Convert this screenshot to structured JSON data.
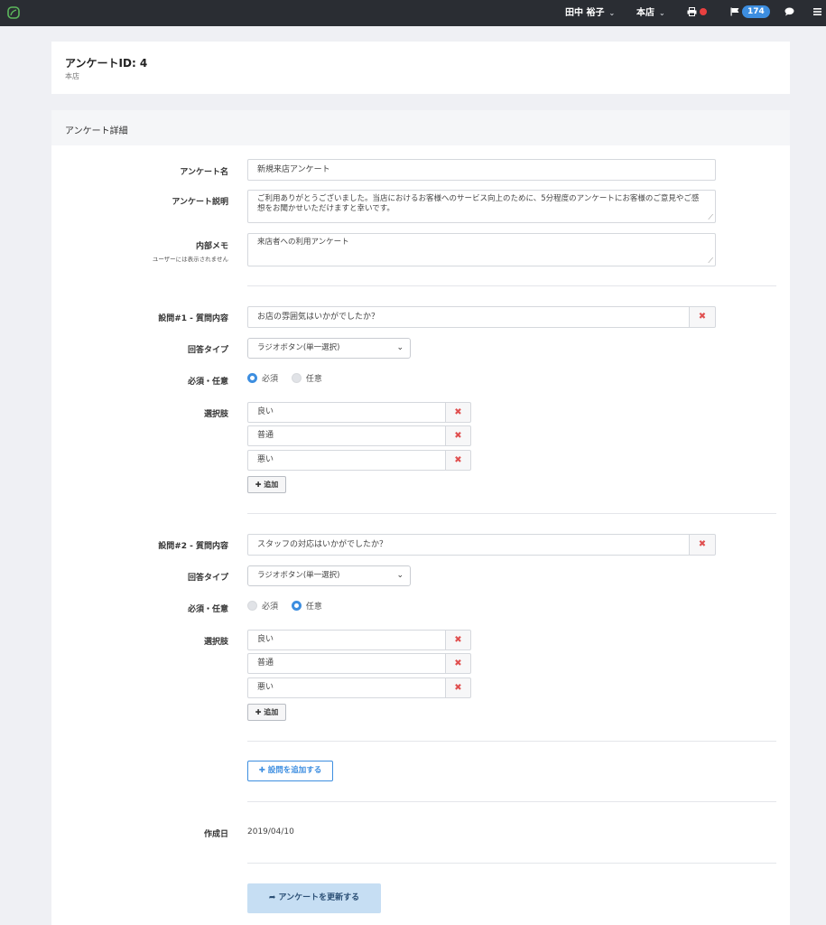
{
  "topbar": {
    "user": "田中 裕子",
    "store": "本店",
    "notification_count": "174",
    "status_color": "#e84040",
    "badge_color": "#3d8ee0"
  },
  "header": {
    "title": "アンケートID: 4",
    "subtitle": "本店"
  },
  "section": {
    "title": "アンケート詳細"
  },
  "form": {
    "name_label": "アンケート名",
    "name_value": "新規来店アンケート",
    "desc_label": "アンケート説明",
    "desc_value": "ご利用ありがとうございました。当店におけるお客様へのサービス向上のために、5分程度のアンケートにお客様のご意見やご感想をお聞かせいただけますと幸いです。",
    "memo_label": "内部メモ",
    "memo_hint": "ユーザーには表示されません",
    "memo_value": "来店者への利用アンケート"
  },
  "questions": [
    {
      "label": "設問#1 - 質問内容",
      "text": "お店の雰囲気はいかがでしたか？",
      "type_label": "回答タイプ",
      "type_value": "ラジオボタン(単一選択)",
      "required_label": "必須・任意",
      "required_option": "必須",
      "optional_option": "任意",
      "selected": "必須",
      "options_label": "選択肢",
      "options": [
        "良い",
        "普通",
        "悪い"
      ],
      "add_label": "追加"
    },
    {
      "label": "設問#2 - 質問内容",
      "text": "スタッフの対応はいかがでしたか？",
      "type_label": "回答タイプ",
      "type_value": "ラジオボタン(単一選択)",
      "required_label": "必須・任意",
      "required_option": "必須",
      "optional_option": "任意",
      "selected": "任意",
      "options_label": "選択肢",
      "options": [
        "良い",
        "普通",
        "悪い"
      ],
      "add_label": "追加"
    }
  ],
  "add_question_label": "設問を追加する",
  "created": {
    "label": "作成日",
    "value": "2019/04/10"
  },
  "submit_label": "アンケートを更新する",
  "accent_color": "#3d8ee0",
  "delete_color": "#e05050"
}
